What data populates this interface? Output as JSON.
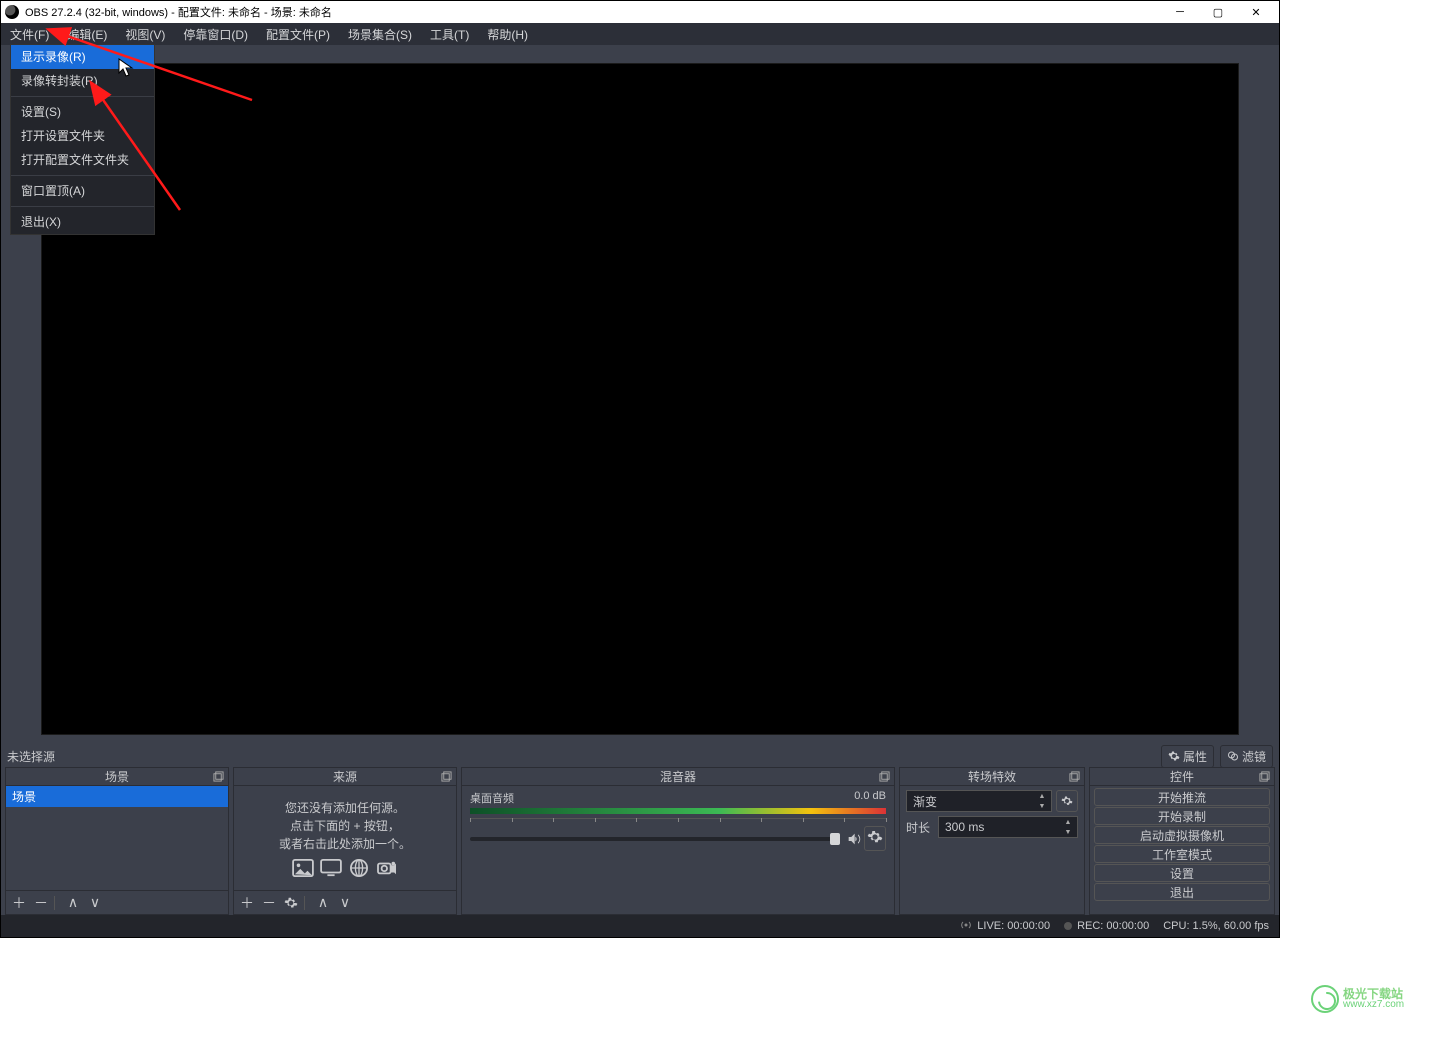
{
  "title": "OBS 27.2.4 (32-bit, windows) - 配置文件: 未命名 - 场景: 未命名",
  "menubar": [
    "文件(F)",
    "编辑(E)",
    "视图(V)",
    "停靠窗口(D)",
    "配置文件(P)",
    "场景集合(S)",
    "工具(T)",
    "帮助(H)"
  ],
  "dropdown": {
    "groups": [
      [
        "显示录像(R)",
        "录像转封装(R)"
      ],
      [
        "设置(S)",
        "打开设置文件夹",
        "打开配置文件文件夹"
      ],
      [
        "窗口置顶(A)"
      ],
      [
        "退出(X)"
      ]
    ],
    "highlighted": "显示录像(R)"
  },
  "toolbar": {
    "no_select": "未选择源",
    "properties": "属性",
    "filters": "滤镜"
  },
  "docks": {
    "scenes": {
      "title": "场景",
      "items": [
        "场景"
      ]
    },
    "sources": {
      "title": "来源",
      "empty_lines": [
        "您还没有添加任何源。",
        "点击下面的 + 按钮，",
        "或者右击此处添加一个。"
      ]
    },
    "mixer": {
      "title": "混音器",
      "channel": "桌面音频",
      "db": "0.0 dB"
    },
    "transitions": {
      "title": "转场特效",
      "type": "渐变",
      "duration_label": "时长",
      "duration_value": "300 ms"
    },
    "controls": {
      "title": "控件",
      "buttons": [
        "开始推流",
        "开始录制",
        "启动虚拟摄像机",
        "工作室模式",
        "设置",
        "退出"
      ]
    }
  },
  "status": {
    "live": "LIVE: 00:00:00",
    "rec": "REC: 00:00:00",
    "cpu": "CPU: 1.5%, 60.00 fps"
  },
  "watermark": {
    "line1": "极光下载站",
    "line2": "www.xz7.com"
  }
}
